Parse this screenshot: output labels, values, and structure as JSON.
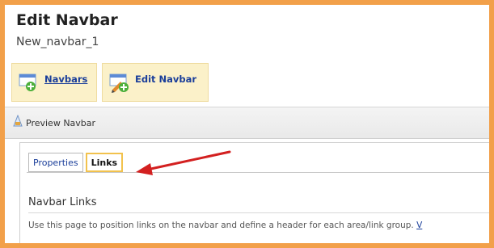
{
  "page": {
    "title": "Edit Navbar",
    "subtitle": "New_navbar_1"
  },
  "toolbar": {
    "navbars_label": "Navbars",
    "edit_navbar_label": "Edit Navbar"
  },
  "preview": {
    "label": "Preview Navbar"
  },
  "tabs": [
    {
      "label": "Properties",
      "active": false
    },
    {
      "label": "Links",
      "active": true
    }
  ],
  "section": {
    "title": "Navbar Links",
    "description": "Use this page to position links on the navbar and define a header for each area/link group.",
    "description_link": "V"
  },
  "colors": {
    "frame_border": "#f2a04a",
    "highlight_bg": "#fbf1c9",
    "link": "#1a3e9a",
    "arrow": "#d32020",
    "tab_highlight": "#f2c24d"
  },
  "icons": [
    "navbar-add-icon",
    "navbar-edit-icon",
    "preview-icon",
    "red-arrow-annotation"
  ]
}
